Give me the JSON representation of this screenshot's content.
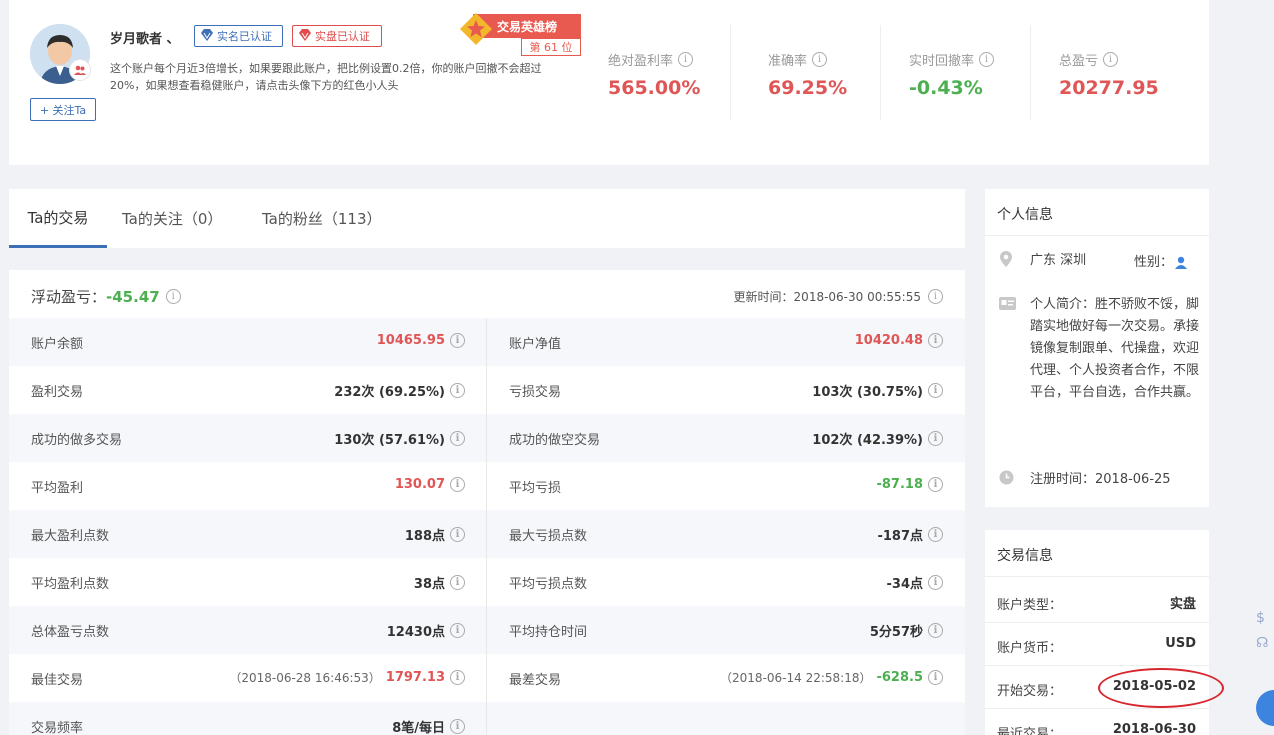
{
  "profile": {
    "username": "岁月歌者 、",
    "badge_realname": "实名已认证",
    "badge_realacct": "实盘已认证",
    "description": "这个账户每个月近3倍增长，如果要跟此账户，把比例设置0.2倍，你的账户回撤不会超过20%，如果想查看稳健账户，请点击头像下方的红色小人头",
    "follow_label": "+ 关注Ta",
    "hero_title": "交易英雄榜",
    "hero_rank": "第 61 位",
    "stats": [
      {
        "label": "绝对盈利率",
        "value": "565.00%"
      },
      {
        "label": "准确率",
        "value": "69.25%"
      },
      {
        "label": "实时回撤率",
        "value": "-0.43%"
      },
      {
        "label": "总盈亏",
        "value": "20277.95"
      }
    ],
    "colors": {
      "red": "#e05555",
      "green": "#4caf50",
      "blue": "#3d6fb6"
    }
  },
  "tabs": [
    "Ta的交易",
    "Ta的关注（0）",
    "Ta的粉丝（113）"
  ],
  "trading": {
    "floating_label": "浮动盈亏：",
    "floating_value": "-45.47",
    "update_time": "更新时间：2018-06-30 00:55:55",
    "rows": [
      {
        "l1": "账户余额",
        "v1": "10465.95",
        "l2": "账户净值",
        "v2": "10420.48"
      },
      {
        "l1": "盈利交易",
        "v1": "232次 (69.25%)",
        "l2": "亏损交易",
        "v2": "103次 (30.75%)"
      },
      {
        "l1": "成功的做多交易",
        "v1": "130次 (57.61%)",
        "l2": "成功的做空交易",
        "v2": "102次 (42.39%)"
      },
      {
        "l1": "平均盈利",
        "v1": "130.07",
        "l2": "平均亏损",
        "v2": "-87.18"
      },
      {
        "l1": "最大盈利点数",
        "v1": "188点",
        "l2": "最大亏损点数",
        "v2": "-187点"
      },
      {
        "l1": "平均盈利点数",
        "v1": "38点",
        "l2": "平均亏损点数",
        "v2": "-34点"
      },
      {
        "l1": "总体盈亏点数",
        "v1": "12430点",
        "l2": "平均持仓时间",
        "v2": "5分57秒"
      },
      {
        "l1": "最佳交易",
        "d1": "（2018-06-28 16:46:53）",
        "v1": "1797.13",
        "l2": "最差交易",
        "d2": "（2018-06-14 22:58:18）",
        "v2": "-628.5"
      },
      {
        "l1": "交易频率",
        "v1": "8笔/每日",
        "l2": "",
        "v2": ""
      }
    ]
  },
  "personal": {
    "title": "个人信息",
    "location": "广东 深圳",
    "gender_label": "性别：",
    "bio": "个人简介：胜不骄败不馁，脚踏实地做好每一次交易。承接镜像复制跟单、代操盘，欢迎代理、个人投资者合作，不限平台，平台自选，合作共赢。",
    "register": "注册时间：2018-06-25"
  },
  "trade_info": {
    "title": "交易信息",
    "rows": [
      {
        "label": "账户类型：",
        "value": "实盘"
      },
      {
        "label": "账户货币：",
        "value": "USD"
      },
      {
        "label": "开始交易：",
        "value": "2018-05-02"
      },
      {
        "label": "最近交易：",
        "value": "2018-06-30"
      }
    ]
  }
}
